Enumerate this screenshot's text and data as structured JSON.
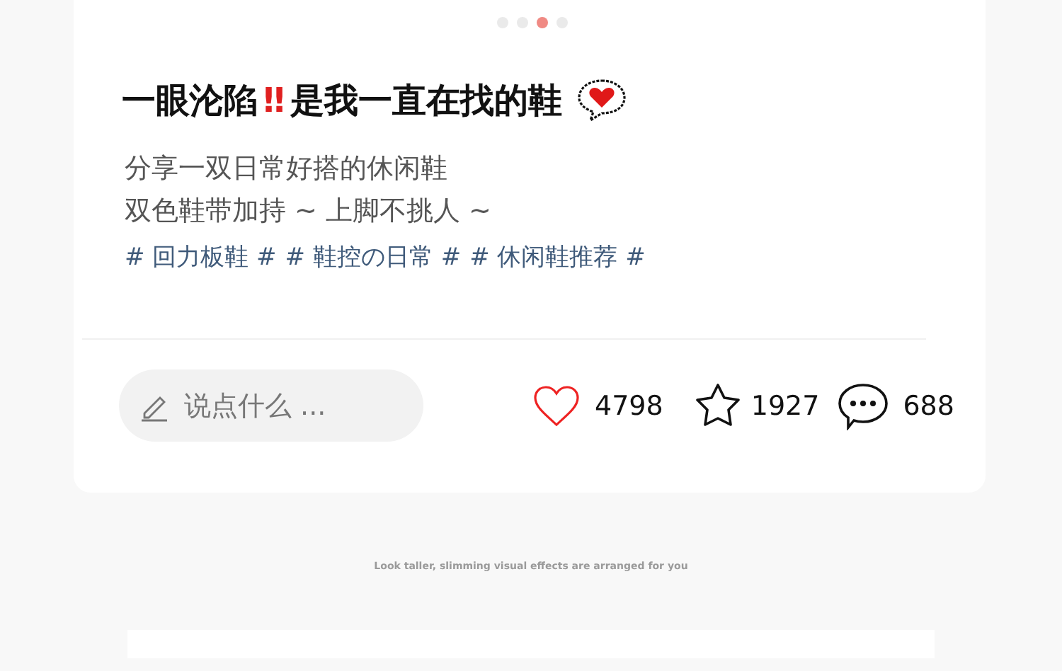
{
  "carousel_dots": [
    {
      "selected": false
    },
    {
      "selected": false
    },
    {
      "selected": true
    },
    {
      "selected": false
    }
  ],
  "title": {
    "before": "一眼沦陷",
    "marks": "‼",
    "after": "是我一直在找的鞋"
  },
  "description": [
    "分享一双日常好搭的休闲鞋",
    "双色鞋带加持 ~ 上脚不挑人 ~"
  ],
  "tags": [
    "# 回力板鞋 #",
    "# 鞋控の日常 #",
    "# 休闲鞋推荐 #"
  ],
  "comment_field": {
    "placeholder": "说点什么 ..."
  },
  "stats": [
    {
      "kind": "like",
      "count": "4798"
    },
    {
      "kind": "favorite",
      "count": "1927"
    },
    {
      "kind": "comment",
      "count": "688"
    }
  ],
  "caption": "Look taller, slimming visual effects are arranged for you"
}
